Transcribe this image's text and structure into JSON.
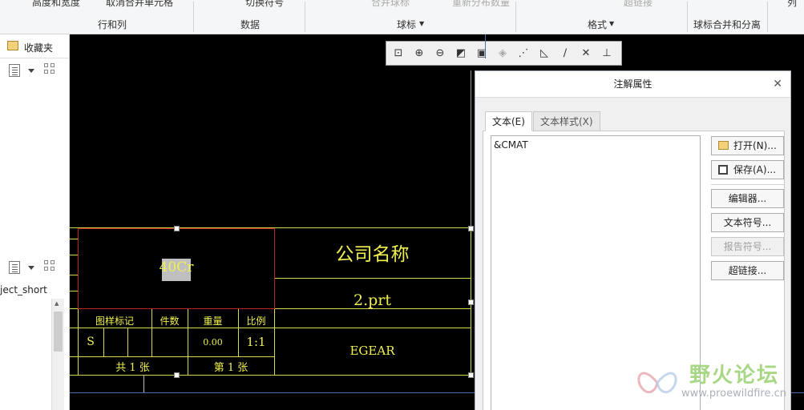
{
  "ribbon": {
    "top_items": [
      "高度和宽度",
      "取消合并单元格",
      "切换符号",
      "合并球标",
      "重新分布数量",
      "超链接",
      "列"
    ],
    "groups": [
      "行和列",
      "数据",
      "球标",
      "格式",
      "球标合并和分离"
    ]
  },
  "left_panel": {
    "favorites_label": "收藏夹",
    "model_item": "ject_short"
  },
  "drawing": {
    "material": "40Cr",
    "company": "公司名称",
    "part": "2.prt",
    "brand": "EGEAR",
    "headers": [
      "图样标记",
      "件数",
      "重量",
      "比例"
    ],
    "mark": "S",
    "weight": "0.00",
    "scale": "1:1",
    "total": "共 1 张",
    "sheet": "第 1 张"
  },
  "dialog": {
    "title": "注解属性",
    "tabs": [
      "文本(E)",
      "文本样式(X)"
    ],
    "text_value": "&CMAT",
    "buttons": {
      "open": "打开(N)...",
      "save": "保存(A)...",
      "editor": "编辑器...",
      "text_symbol": "文本符号...",
      "report_symbol": "报告符号...",
      "hyperlink": "超链接..."
    }
  },
  "watermark": {
    "name": "野火论坛",
    "url": "www.proewildfire.cn"
  }
}
